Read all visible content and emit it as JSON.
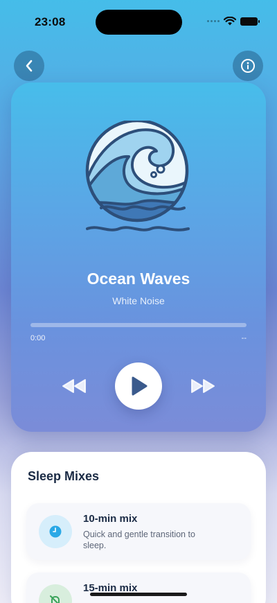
{
  "status_bar": {
    "time": "23:08"
  },
  "nav": {
    "back_icon": "chevron-left-icon",
    "info_icon": "info-icon"
  },
  "player": {
    "artwork_icon": "ocean-wave-icon",
    "title": "Ocean Waves",
    "subtitle": "White Noise",
    "progress_fraction": 0,
    "elapsed": "0:00",
    "total": "--",
    "controls": {
      "rewind_icon": "rewind-icon",
      "play_icon": "play-icon",
      "forward_icon": "fast-forward-icon"
    }
  },
  "mixes": {
    "title": "Sleep Mixes",
    "items": [
      {
        "name": "10-min mix",
        "description": "Quick and gentle transition to sleep.",
        "icon": "clock-icon",
        "icon_color": "#2aa8e6"
      },
      {
        "name": "15-min mix",
        "description": "",
        "icon": "bell-off-icon",
        "icon_color": "#3aa35a"
      }
    ]
  },
  "colors": {
    "accent": "#45bde9",
    "dark_text": "#1b2b45",
    "play_icon": "#3a5a8c"
  }
}
